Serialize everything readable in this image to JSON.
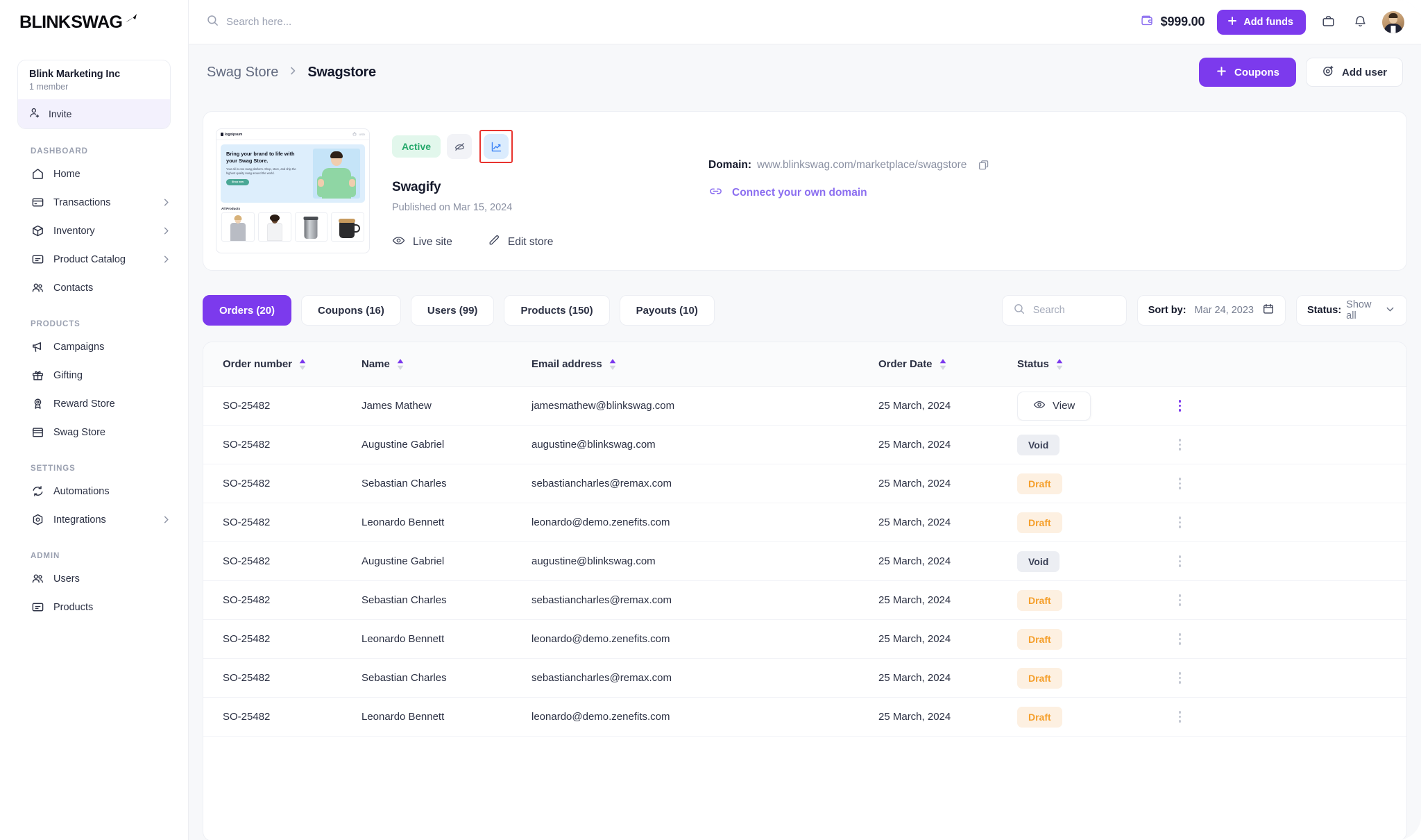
{
  "brand": {
    "name_bold": "BLINK",
    "name_thin": "SWAG",
    "logo_icon": "swoosh-icon"
  },
  "org": {
    "name": "Blink Marketing Inc",
    "members": "1 member",
    "invite_label": "Invite"
  },
  "sidebar": {
    "sections": [
      {
        "label": "DASHBOARD",
        "items": [
          {
            "label": "Home",
            "icon": "home-icon",
            "chevron": false
          },
          {
            "label": "Transactions",
            "icon": "card-icon",
            "chevron": true
          },
          {
            "label": "Inventory",
            "icon": "box-icon",
            "chevron": true
          },
          {
            "label": "Product Catalog",
            "icon": "catalog-icon",
            "chevron": true
          },
          {
            "label": "Contacts",
            "icon": "people-icon",
            "chevron": false
          }
        ]
      },
      {
        "label": "PRODUCTS",
        "items": [
          {
            "label": "Campaigns",
            "icon": "megaphone-icon",
            "chevron": false
          },
          {
            "label": "Gifting",
            "icon": "gift-icon",
            "chevron": false
          },
          {
            "label": "Reward Store",
            "icon": "award-icon",
            "chevron": false
          },
          {
            "label": "Swag Store",
            "icon": "storefront-icon",
            "chevron": false
          }
        ]
      },
      {
        "label": "SETTINGS",
        "items": [
          {
            "label": "Automations",
            "icon": "refresh-icon",
            "chevron": false
          },
          {
            "label": "Integrations",
            "icon": "hexagon-icon",
            "chevron": true
          }
        ]
      },
      {
        "label": "ADMIN",
        "items": [
          {
            "label": "Users",
            "icon": "people-icon",
            "chevron": false
          },
          {
            "label": "Products",
            "icon": "catalog-icon",
            "chevron": false
          }
        ]
      }
    ]
  },
  "topbar": {
    "search_placeholder": "Search here...",
    "search_value": "",
    "balance": "$999.00",
    "wallet_icon": "wallet-icon",
    "add_funds_label": "Add funds",
    "bag_icon": "bag-icon",
    "bell_icon": "bell-icon",
    "avatar_icon": "user-avatar"
  },
  "page": {
    "breadcrumb_parent": "Swag Store",
    "breadcrumb_separator": "›",
    "breadcrumb_current": "Swagstore",
    "coupons_label": "Coupons",
    "add_user_label": "Add user"
  },
  "store": {
    "status_badge": "Active",
    "eye_off_icon": "eye-off-icon",
    "chart_icon": "chart-line-icon",
    "highlight_color": "#e8332e",
    "name": "Swagify",
    "published": "Published on Mar 15, 2024",
    "live_site_label": "Live site",
    "edit_store_label": "Edit store",
    "domain_label": "Domain:",
    "domain_value": "www.blinkswag.com/marketplace/swagstore",
    "copy_icon": "copy-icon",
    "connect_domain_label": "Connect your own domain",
    "link_icon": "link-icon",
    "preview": {
      "logo": "logoipsum",
      "currency": "USD",
      "hero_title": "Bring your brand to life with your Swag Store.",
      "hero_body": "Your all-in-one swag platform. Shop, store, and ship the highest quality swag around the world.",
      "cta": "Shop now",
      "section_title": "All Products"
    }
  },
  "tabs": [
    {
      "label": "Orders (20)",
      "active": true
    },
    {
      "label": "Coupons (16)",
      "active": false
    },
    {
      "label": "Users (99)",
      "active": false
    },
    {
      "label": "Products (150)",
      "active": false
    },
    {
      "label": "Payouts (10)",
      "active": false
    }
  ],
  "filters": {
    "search_placeholder": "Search",
    "search_value": "",
    "sort_label": "Sort by:",
    "sort_value": "Mar 24, 2023",
    "calendar_icon": "calendar-icon",
    "status_label": "Status:",
    "status_value": "Show all",
    "chevron_icon": "chevron-down-icon"
  },
  "table": {
    "columns": [
      "Order number",
      "Name",
      "Email address",
      "",
      "Order Date",
      "Status"
    ],
    "sort_asc_color": "#7c3aed",
    "sort_desc_color": "#d4d7e0",
    "view_label": "View",
    "eye_icon": "eye-icon",
    "kebab_icon": "kebab-menu-icon",
    "rows": [
      {
        "order": "SO-25482",
        "name": "James Mathew",
        "email": "jamesmathew@blinkswag.com",
        "date": "25 March, 2024",
        "status": "View",
        "hovered": true
      },
      {
        "order": "SO-25482",
        "name": "Augustine Gabriel",
        "email": "augustine@blinkswag.com",
        "date": "25 March, 2024",
        "status": "Void",
        "hovered": false
      },
      {
        "order": "SO-25482",
        "name": "Sebastian Charles",
        "email": "sebastiancharles@remax.com",
        "date": "25 March, 2024",
        "status": "Draft",
        "hovered": false
      },
      {
        "order": "SO-25482",
        "name": "Leonardo Bennett",
        "email": "leonardo@demo.zenefits.com",
        "date": "25 March, 2024",
        "status": "Draft",
        "hovered": false
      },
      {
        "order": "SO-25482",
        "name": "Augustine Gabriel",
        "email": "augustine@blinkswag.com",
        "date": "25 March, 2024",
        "status": "Void",
        "hovered": false
      },
      {
        "order": "SO-25482",
        "name": "Sebastian Charles",
        "email": "sebastiancharles@remax.com",
        "date": "25 March, 2024",
        "status": "Draft",
        "hovered": false
      },
      {
        "order": "SO-25482",
        "name": "Leonardo Bennett",
        "email": "leonardo@demo.zenefits.com",
        "date": "25 March, 2024",
        "status": "Draft",
        "hovered": false
      },
      {
        "order": "SO-25482",
        "name": "Sebastian Charles",
        "email": "sebastiancharles@remax.com",
        "date": "25 March, 2024",
        "status": "Draft",
        "hovered": false
      },
      {
        "order": "SO-25482",
        "name": "Leonardo Bennett",
        "email": "leonardo@demo.zenefits.com",
        "date": "25 March, 2024",
        "status": "Draft",
        "hovered": false
      }
    ]
  },
  "colors": {
    "accent": "#7c3aed",
    "accent_soft": "#f3f1fd",
    "active_green": "#26a96c",
    "draft_orange": "#f59f2b"
  }
}
